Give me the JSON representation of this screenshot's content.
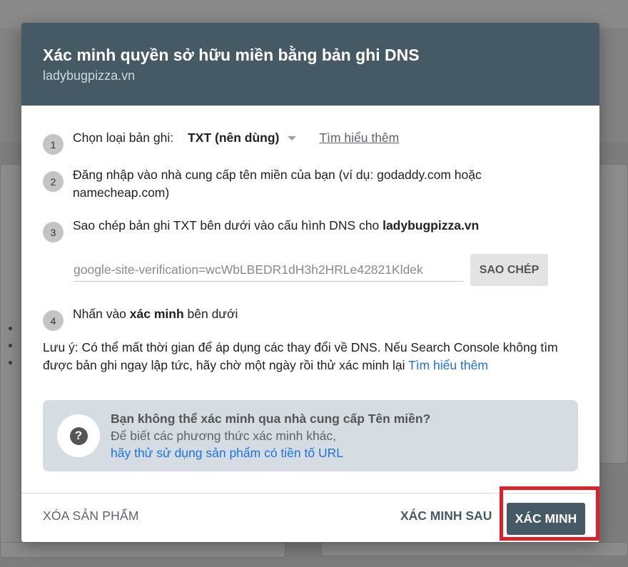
{
  "dialog": {
    "title": "Xác minh quyền sở hữu miền bằng bản ghi DNS",
    "subtitle": "ladybugpizza.vn"
  },
  "steps": [
    {
      "number": "1",
      "label": "Chọn loại bản ghi:",
      "select_value": "TXT (nên dùng)",
      "learn_more": "Tìm hiểu thêm"
    },
    {
      "number": "2",
      "text": "Đăng nhập vào nhà cung cấp tên miền của bạn (ví dụ: godaddy.com hoặc namecheap.com)"
    },
    {
      "number": "3",
      "text_prefix": "Sao chép bản ghi TXT bên dưới vào cấu hình DNS cho ",
      "domain": "ladybugpizza.vn",
      "txt_record": "google-site-verification=wcWbLBEDR1dH3h2HRLe42821Kldek",
      "copy_button": "SAO CHÉP"
    },
    {
      "number": "4",
      "text_prefix": "Nhấn vào ",
      "bold": "xác minh",
      "text_suffix": " bên dưới"
    }
  ],
  "note": {
    "text": "Lưu ý: Có thể mất thời gian để áp dụng các thay đổi về DNS. Nếu Search Console không tìm được bản ghi ngay lập tức, hãy chờ một ngày rồi thử xác minh lại ",
    "link": "Tìm hiểu thêm"
  },
  "info_box": {
    "icon": "help-icon",
    "title": "Bạn không thể xác minh qua nhà cung cấp Tên miền?",
    "line": "Để biết các phương thức xác minh khác,",
    "link": "hãy thử sử dụng sản phẩm có tiền tố URL"
  },
  "footer": {
    "delete_label": "XÓA SẢN PHẨM",
    "later_label": "XÁC MINH SAU",
    "verify_label": "XÁC MINH"
  },
  "colors": {
    "header_bg": "#455a64",
    "primary_button": "#455a64",
    "link": "#1a73e8",
    "highlight": "#e01f26",
    "info_bg": "#d6dde2"
  }
}
